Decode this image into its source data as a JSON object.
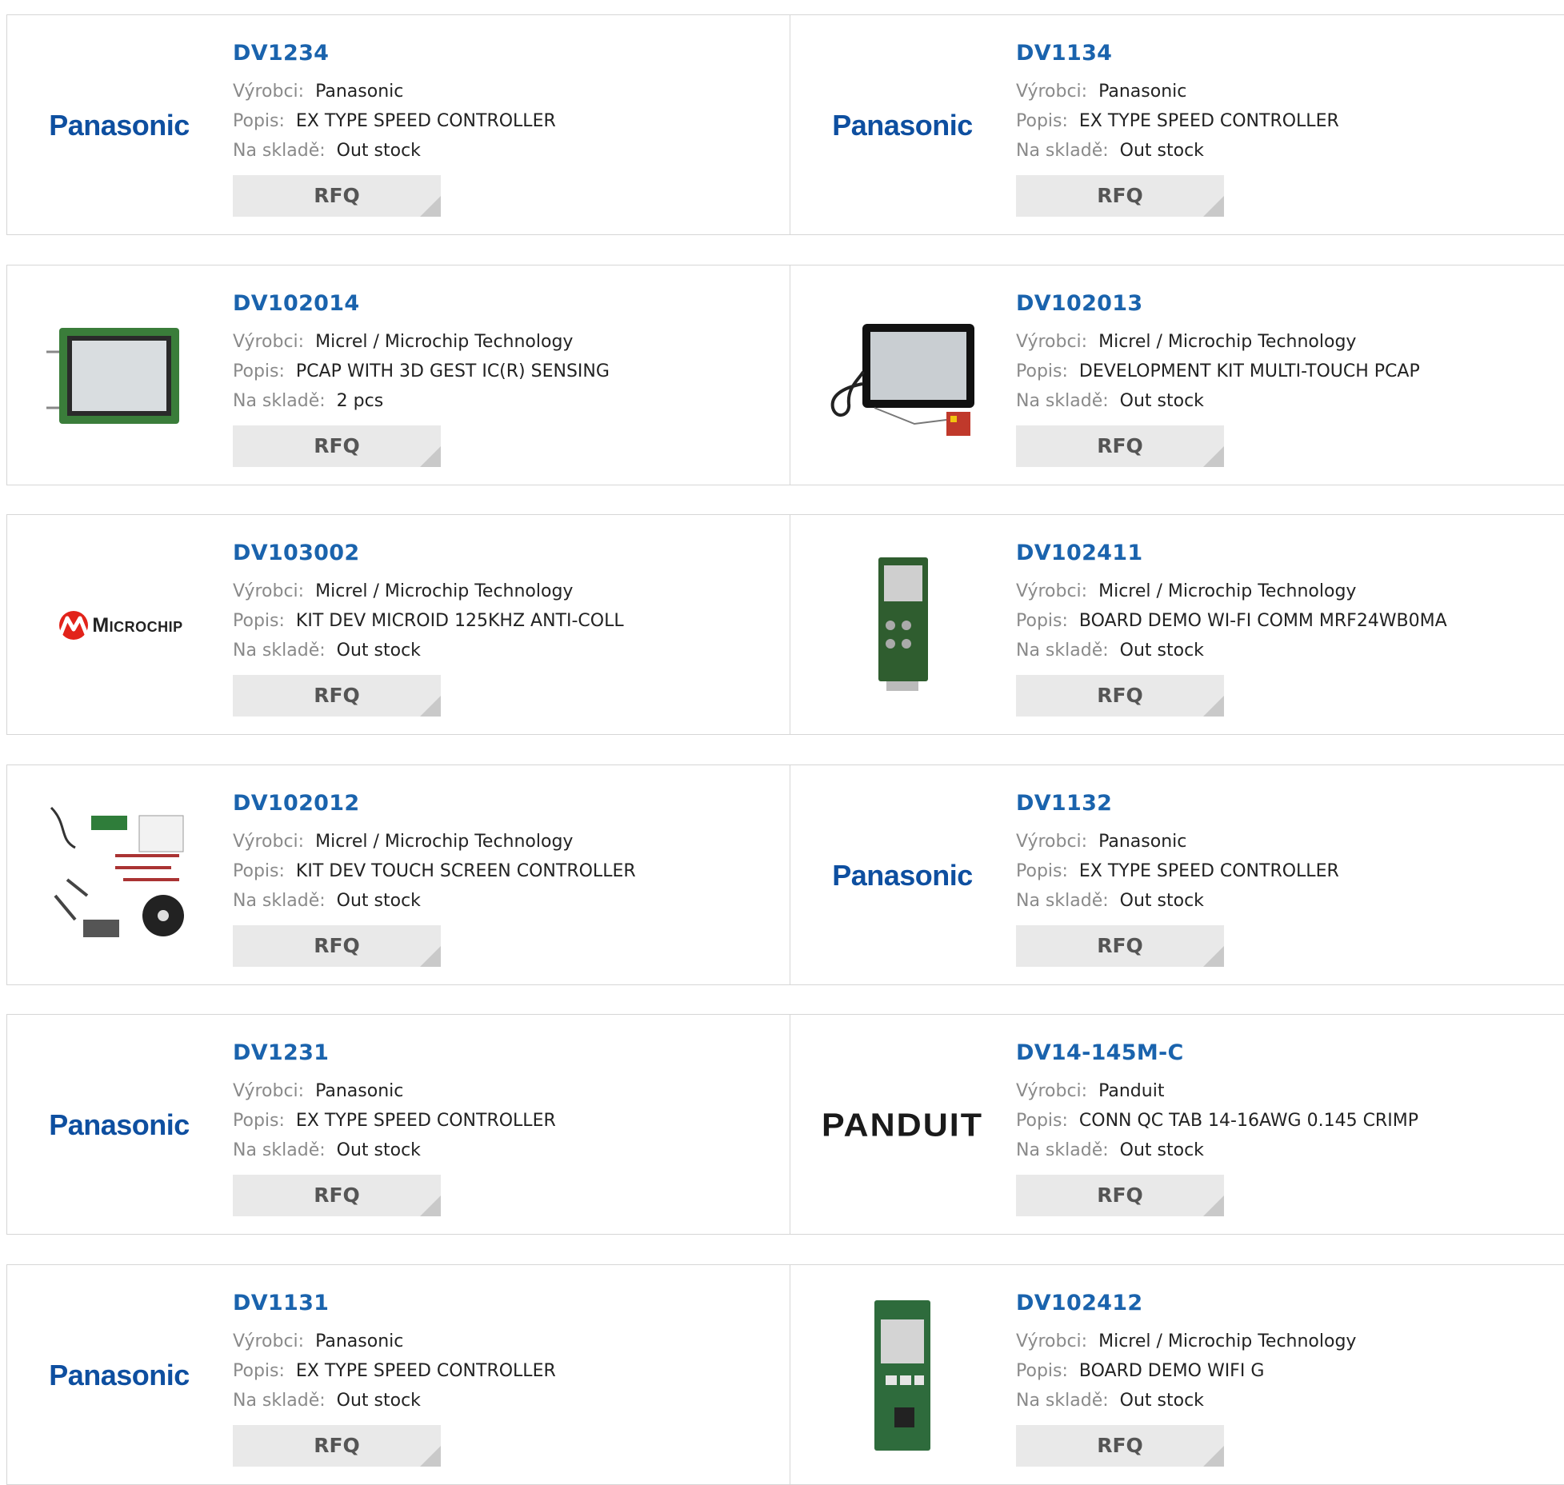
{
  "labels": {
    "manufacturer": "Výrobci:",
    "description": "Popis:",
    "stock": "Na skladě:",
    "rfq": "RFQ"
  },
  "colors": {
    "part_link": "#1a63ad",
    "label_gray": "#8a8a8a",
    "rfq_bg": "#e9e9e9",
    "panasonic_blue": "#0e4fa0",
    "microchip_red": "#e2231a"
  },
  "products": [
    {
      "part": "DV1234",
      "manufacturer": "Panasonic",
      "description": "EX TYPE SPEED CONTROLLER",
      "stock": "Out stock",
      "image": "panasonic-logo",
      "logo_text": "Panasonic"
    },
    {
      "part": "DV1134",
      "manufacturer": "Panasonic",
      "description": "EX TYPE SPEED CONTROLLER",
      "stock": "Out stock",
      "image": "panasonic-logo",
      "logo_text": "Panasonic"
    },
    {
      "part": "DV102014",
      "manufacturer": "Micrel / Microchip Technology",
      "description": "PCAP WITH 3D GEST IC(R) SENSING",
      "stock": "2 pcs",
      "image": "touch-display-photo"
    },
    {
      "part": "DV102013",
      "manufacturer": "Micrel / Microchip Technology",
      "description": "DEVELOPMENT KIT MULTI-TOUCH PCAP",
      "stock": "Out stock",
      "image": "touch-panel-kit-photo"
    },
    {
      "part": "DV103002",
      "manufacturer": "Micrel / Microchip Technology",
      "description": "KIT DEV MICROID 125KHZ ANTI-COLL",
      "stock": "Out stock",
      "image": "microchip-logo",
      "logo_text": "Microchip"
    },
    {
      "part": "DV102411",
      "manufacturer": "Micrel / Microchip Technology",
      "description": "BOARD DEMO WI-FI COMM MRF24WB0MA",
      "stock": "Out stock",
      "image": "wifi-board-photo"
    },
    {
      "part": "DV102012",
      "manufacturer": "Micrel / Microchip Technology",
      "description": "KIT DEV TOUCH SCREEN CONTROLLER",
      "stock": "Out stock",
      "image": "cable-kit-photo"
    },
    {
      "part": "DV1132",
      "manufacturer": "Panasonic",
      "description": "EX TYPE SPEED CONTROLLER",
      "stock": "Out stock",
      "image": "panasonic-logo",
      "logo_text": "Panasonic"
    },
    {
      "part": "DV1231",
      "manufacturer": "Panasonic",
      "description": "EX TYPE SPEED CONTROLLER",
      "stock": "Out stock",
      "image": "panasonic-logo",
      "logo_text": "Panasonic"
    },
    {
      "part": "DV14-145M-C",
      "manufacturer": "Panduit",
      "description": "CONN QC TAB 14-16AWG 0.145 CRIMP",
      "stock": "Out stock",
      "image": "panduit-logo",
      "logo_text": "Panduit"
    },
    {
      "part": "DV1131",
      "manufacturer": "Panasonic",
      "description": "EX TYPE SPEED CONTROLLER",
      "stock": "Out stock",
      "image": "panasonic-logo",
      "logo_text": "Panasonic"
    },
    {
      "part": "DV102412",
      "manufacturer": "Micrel / Microchip Technology",
      "description": "BOARD DEMO WIFI G",
      "stock": "Out stock",
      "image": "wifi-module-photo"
    }
  ]
}
